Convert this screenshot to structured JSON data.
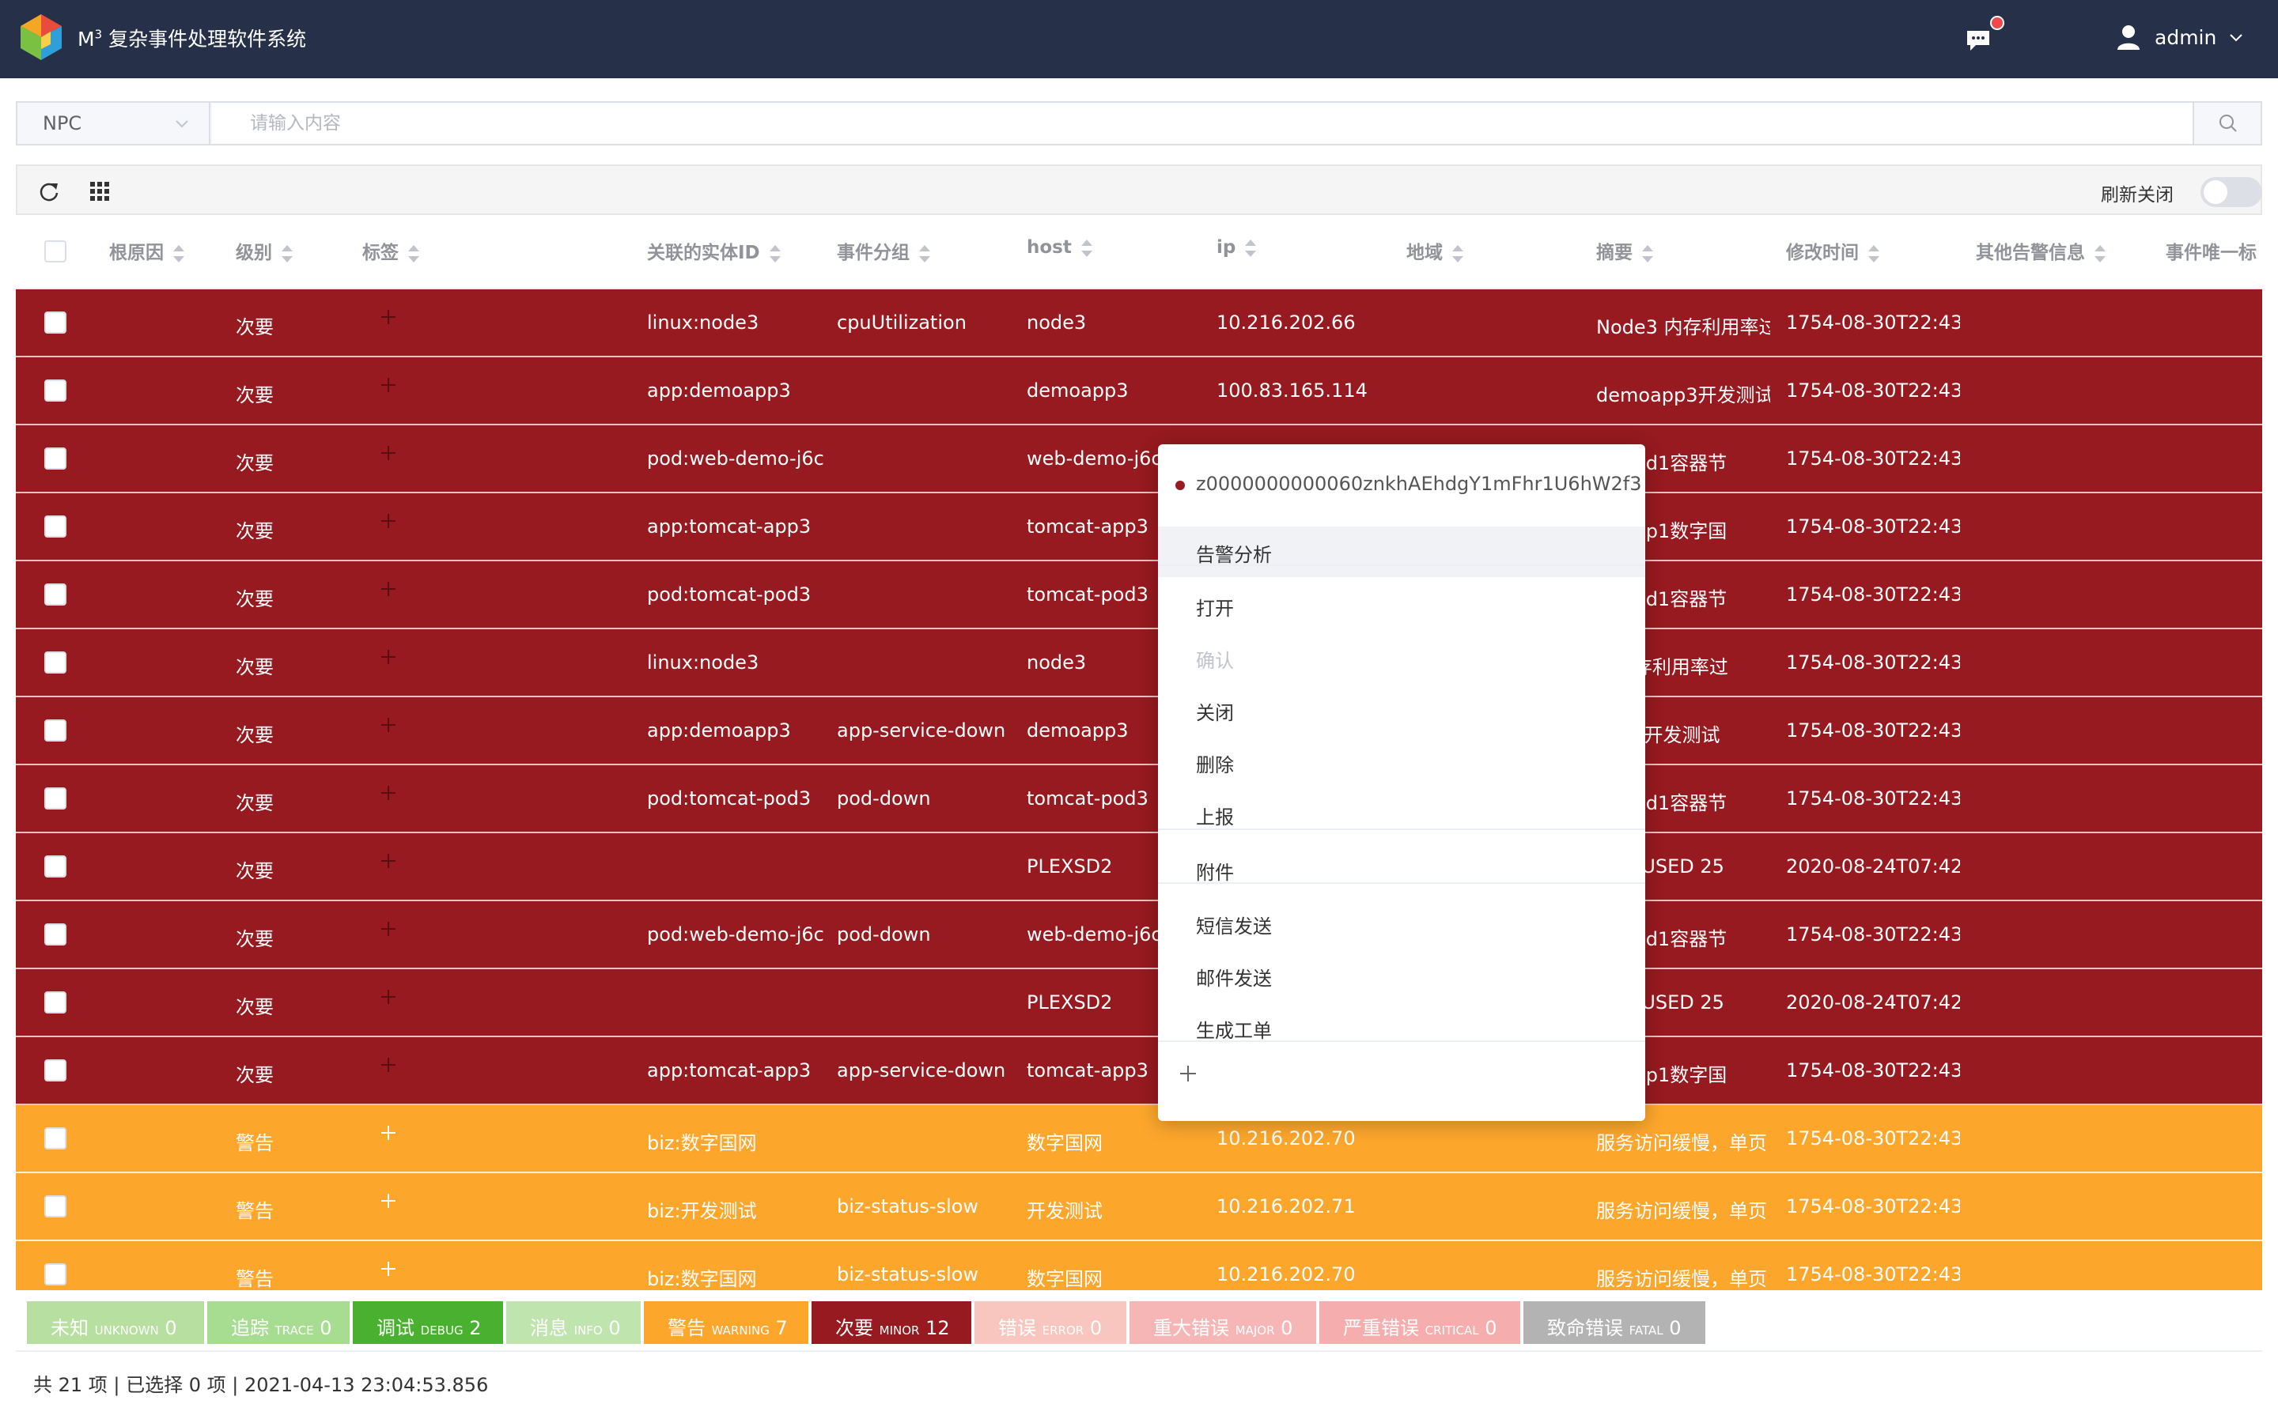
{
  "header": {
    "app_title_prefix": "M",
    "app_title_sup": "3",
    "app_title": "复杂事件处理软件系统",
    "user_name": "admin"
  },
  "search": {
    "field_value": "NPC",
    "placeholder": "请输入内容"
  },
  "toolbar": {
    "refresh_toggle_label": "刷新关闭",
    "refresh_on": false
  },
  "table": {
    "columns": [
      "根原因",
      "级别",
      "标签",
      "关联的实体ID",
      "事件分组",
      "host",
      "ip",
      "地域",
      "摘要",
      "修改时间",
      "其他告警信息",
      "事件唯一标"
    ],
    "rows": [
      {
        "severity": "minor",
        "level": "次要",
        "entity": "linux:node3",
        "group": "cpuUtilization",
        "host": "node3",
        "ip": "10.216.202.66",
        "summary": "Node3 内存利用率过",
        "time": "1754-08-30T22:43"
      },
      {
        "severity": "minor",
        "level": "次要",
        "entity": "app:demoapp3",
        "group": "",
        "host": "demoapp3",
        "ip": "100.83.165.114",
        "summary": "demoapp3开发测试",
        "time": "1754-08-30T22:43"
      },
      {
        "severity": "minor",
        "level": "次要",
        "entity": "pod:web-demo-j6c",
        "group": "",
        "host": "web-demo-j6c",
        "ip": "",
        "summary": "at-pod1容器节",
        "time": "1754-08-30T22:43"
      },
      {
        "severity": "minor",
        "level": "次要",
        "entity": "app:tomcat-app3",
        "group": "",
        "host": "tomcat-app3",
        "ip": "",
        "summary": "at-app1数字国",
        "time": "1754-08-30T22:43"
      },
      {
        "severity": "minor",
        "level": "次要",
        "entity": "pod:tomcat-pod3",
        "group": "",
        "host": "tomcat-pod3",
        "ip": "",
        "summary": "at-pod1容器节",
        "time": "1754-08-30T22:43"
      },
      {
        "severity": "minor",
        "level": "次要",
        "entity": "linux:node3",
        "group": "",
        "host": "node3",
        "ip": "",
        "summary": "3 内存利用率过",
        "time": "1754-08-30T22:43"
      },
      {
        "severity": "minor",
        "level": "次要",
        "entity": "app:demoapp3",
        "group": "app-service-down",
        "host": "demoapp3",
        "ip": "",
        "summary": "app3开发测试",
        "time": "1754-08-30T22:43"
      },
      {
        "severity": "minor",
        "level": "次要",
        "entity": "pod:tomcat-pod3",
        "group": "pod-down",
        "host": "tomcat-pod3",
        "ip": "",
        "summary": "at-pod1容器节",
        "time": "1754-08-30T22:43"
      },
      {
        "severity": "minor",
        "level": "次要",
        "entity": "",
        "group": "",
        "host": "PLEXSD2",
        "ip": "",
        "summary": "HAS USED 25",
        "time": "2020-08-24T07:42"
      },
      {
        "severity": "minor",
        "level": "次要",
        "entity": "pod:web-demo-j6c",
        "group": "pod-down",
        "host": "web-demo-j6c",
        "ip": "",
        "summary": "at-pod1容器节",
        "time": "1754-08-30T22:43"
      },
      {
        "severity": "minor",
        "level": "次要",
        "entity": "",
        "group": "",
        "host": "PLEXSD2",
        "ip": "",
        "summary": "HAS USED 25",
        "time": "2020-08-24T07:42"
      },
      {
        "severity": "minor",
        "level": "次要",
        "entity": "app:tomcat-app3",
        "group": "app-service-down",
        "host": "tomcat-app3",
        "ip": "",
        "summary": "at-app1数字国",
        "time": "1754-08-30T22:43"
      },
      {
        "severity": "warning",
        "level": "警告",
        "entity": "biz:数字国网",
        "group": "",
        "host": "数字国网",
        "ip": "10.216.202.70",
        "summary": "服务访问缓慢，单页",
        "time": "1754-08-30T22:43"
      },
      {
        "severity": "warning",
        "level": "警告",
        "entity": "biz:开发测试",
        "group": "biz-status-slow",
        "host": "开发测试",
        "ip": "10.216.202.71",
        "summary": "服务访问缓慢，单页",
        "time": "1754-08-30T22:43"
      },
      {
        "severity": "warning",
        "level": "警告",
        "entity": "biz:数字国网",
        "group": "biz-status-slow",
        "host": "数字国网",
        "ip": "10.216.202.70",
        "summary": "服务访问缓慢，单页",
        "time": "1754-08-30T22:43"
      }
    ]
  },
  "context_menu": {
    "event_id": "z0000000000060znkhAEhdgY1mFhr1U6hW2f3",
    "items": [
      {
        "label": "告警分析",
        "state": "active"
      },
      {
        "label": "打开",
        "state": "normal"
      },
      {
        "label": "确认",
        "state": "disabled"
      },
      {
        "label": "关闭",
        "state": "normal"
      },
      {
        "label": "删除",
        "state": "normal"
      },
      {
        "label": "上报",
        "state": "normal"
      },
      {
        "label": "附件",
        "state": "normal"
      },
      {
        "label": "短信发送",
        "state": "normal"
      },
      {
        "label": "邮件发送",
        "state": "normal"
      },
      {
        "label": "生成工单",
        "state": "normal"
      }
    ]
  },
  "legend": [
    {
      "cn": "未知",
      "en": "UNKNOWN",
      "count": "0",
      "color": "#b7e0a0"
    },
    {
      "cn": "追踪",
      "en": "TRACE",
      "count": "0",
      "color": "#a6dd90"
    },
    {
      "cn": "调试",
      "en": "DEBUG",
      "count": "2",
      "color": "#49b030"
    },
    {
      "cn": "消息",
      "en": "INFO",
      "count": "0",
      "color": "#bfe4ae"
    },
    {
      "cn": "警告",
      "en": "WARNING",
      "count": "7",
      "color": "#fca62c"
    },
    {
      "cn": "次要",
      "en": "MINOR",
      "count": "12",
      "color": "#961a1f"
    },
    {
      "cn": "错误",
      "en": "ERROR",
      "count": "0",
      "color": "#f8c6bf"
    },
    {
      "cn": "重大错误",
      "en": "MAJOR",
      "count": "0",
      "color": "#f7b6b6"
    },
    {
      "cn": "严重错误",
      "en": "CRITICAL",
      "count": "0",
      "color": "#f5adad"
    },
    {
      "cn": "致命错误",
      "en": "FATAL",
      "count": "0",
      "color": "#b3b3b3"
    }
  ],
  "footer": {
    "status": "共 21 项 | 已选择 0 项 | 2021-04-13 23:04:53.856"
  }
}
